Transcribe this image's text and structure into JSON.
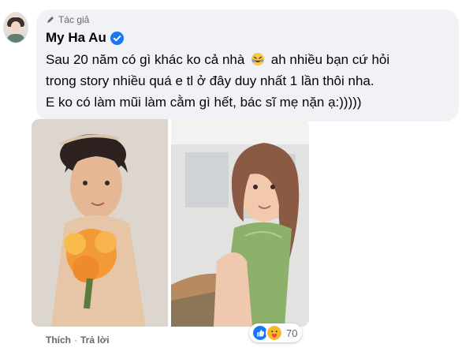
{
  "comment": {
    "author_tag": "Tác giả",
    "author_name": "My Ha Au",
    "lines": [
      "Sau 20 năm có gì khác ko cả nhà",
      "ah nhiều bạn cứ hỏi",
      "trong story nhiều quá e tl ở đây duy nhất 1 lần thôi nha.",
      "E ko có làm mũi làm cằm gì hết, bác sĩ mẹ nặn ạ:)))))"
    ],
    "reaction_count": "70"
  },
  "actions": {
    "like": "Thích",
    "separator": "·",
    "reply": "Trả lời"
  },
  "icons": {
    "author": "pen-icon",
    "verified": "verified-badge-icon",
    "emoji": "rolling-laughing-emoji-icon",
    "reactions": [
      "like-reaction-icon",
      "care-reaction-icon"
    ]
  },
  "colors": {
    "bubble": "#f0f2f5",
    "verified_blue": "#1877f2",
    "secondary_text": "#65676b"
  }
}
